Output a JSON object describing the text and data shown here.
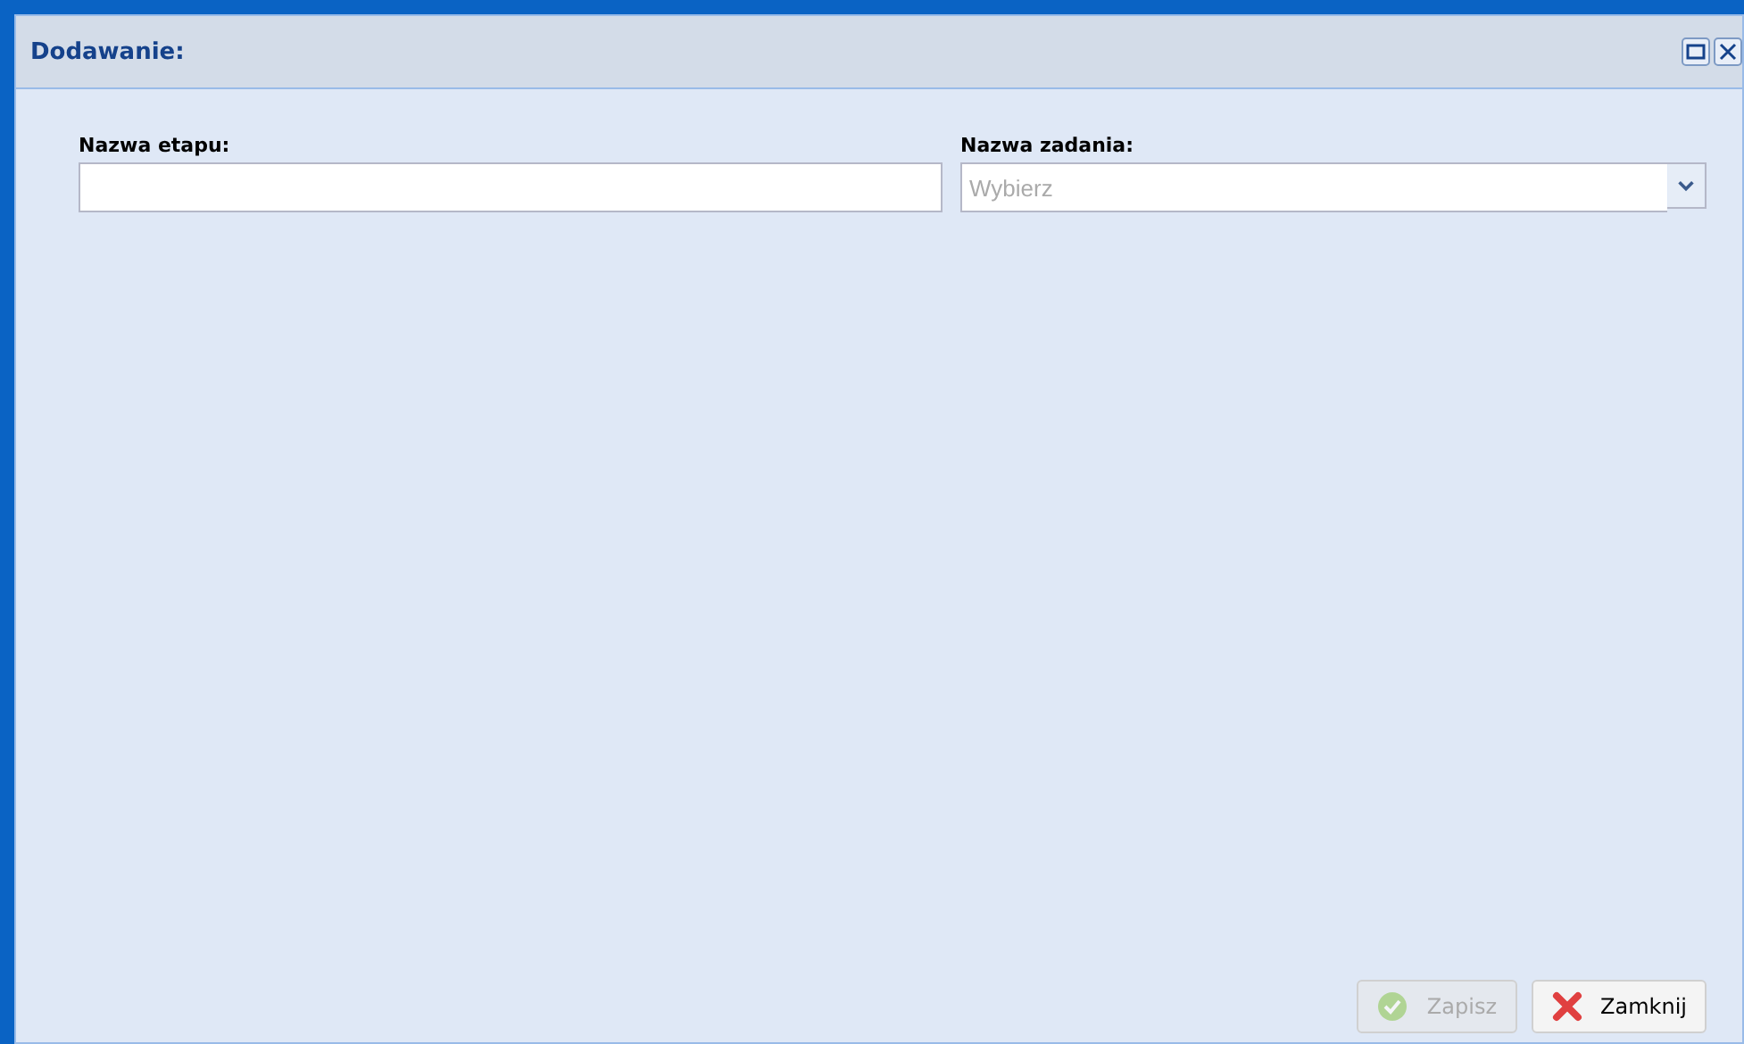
{
  "window": {
    "title": "Dodawanie:"
  },
  "fields": [
    {
      "kind": "text",
      "label": "Nazwa etapu:"
    },
    {
      "kind": "select",
      "label": "Nazwa zadania:",
      "placeholder": "Wybierz"
    }
  ],
  "buttons": [
    {
      "kind": "save",
      "label": "Zapisz",
      "disabled": true
    },
    {
      "kind": "close",
      "label": "Zamknij",
      "disabled": false
    }
  ]
}
